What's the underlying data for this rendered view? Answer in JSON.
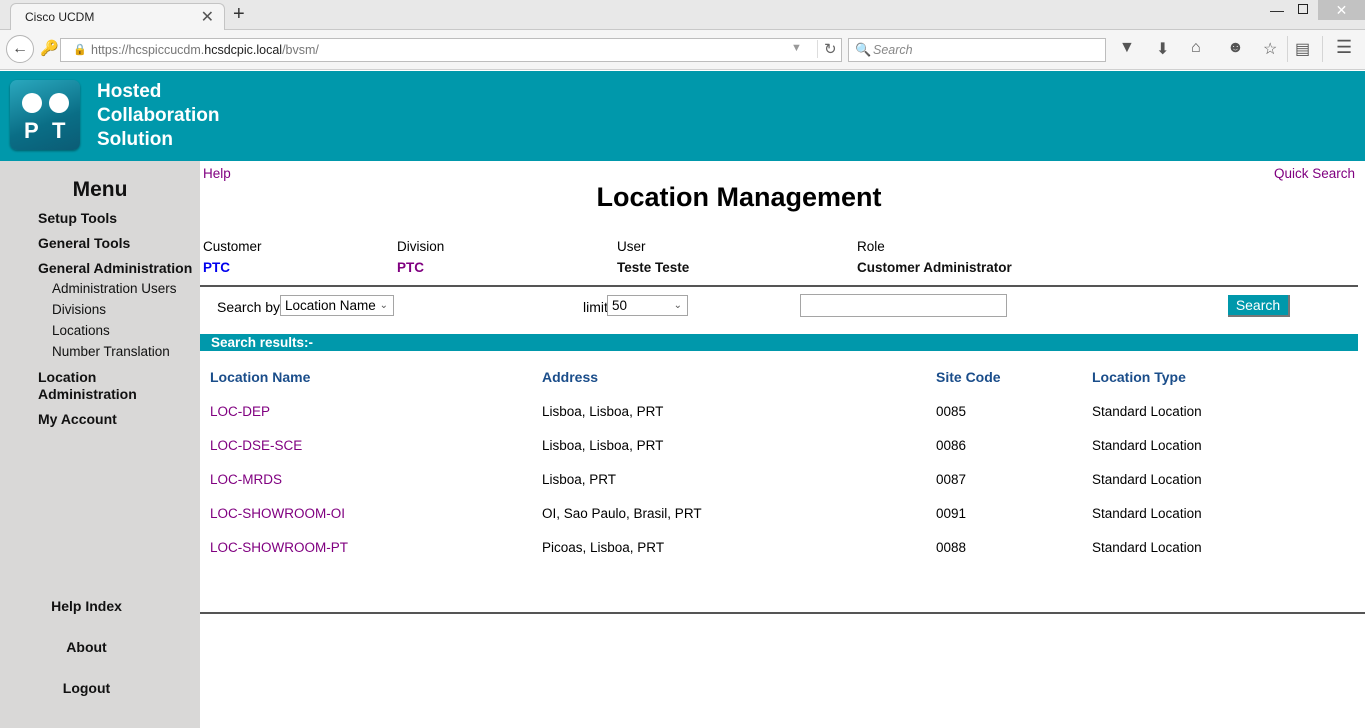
{
  "browser": {
    "tab_title": "Cisco UCDM",
    "tab_close": "✕",
    "new_tab": "+",
    "url_prefix": "https://hcspiccucdm.",
    "url_domain": "hcsdcpic.local",
    "url_path": "/bvsm/",
    "search_placeholder": "Search",
    "window_min": "—",
    "window_close": "✕"
  },
  "header": {
    "logo_letters": [
      "P",
      "T"
    ],
    "brand_lines": [
      "Hosted",
      "Collaboration",
      "Solution"
    ],
    "colors": {
      "teal": "#0098ab"
    }
  },
  "sidebar": {
    "title": "Menu",
    "items": [
      {
        "label": "Setup Tools"
      },
      {
        "label": "General Tools"
      },
      {
        "label": "General Administration",
        "children": [
          {
            "label": "Administration Users"
          },
          {
            "label": "Divisions"
          },
          {
            "label": "Locations"
          },
          {
            "label": "Number Translation"
          }
        ]
      },
      {
        "label": "Location Administration"
      },
      {
        "label": "My Account"
      }
    ],
    "footer": [
      {
        "label": "Help Index"
      },
      {
        "label": "About"
      },
      {
        "label": "Logout"
      }
    ]
  },
  "main": {
    "help_label": "Help",
    "quick_search_label": "Quick Search",
    "title": "Location Management",
    "info": {
      "customer_label": "Customer",
      "customer_value": "PTC",
      "division_label": "Division",
      "division_value": "PTC",
      "user_label": "User",
      "user_value": "Teste Teste",
      "role_label": "Role",
      "role_value": "Customer Administrator"
    },
    "search": {
      "search_by_label": "Search by",
      "search_by_selected": "Location Name",
      "limit_label": "limit",
      "limit_selected": "50",
      "query_value": "",
      "button_label": "Search"
    },
    "results_label": "Search results:-",
    "table": {
      "columns": [
        "Location Name",
        "Address",
        "Site Code",
        "Location Type"
      ],
      "rows": [
        {
          "name": "LOC-DEP",
          "address": "Lisboa, Lisboa, PRT",
          "site_code": "0085",
          "type": "Standard Location"
        },
        {
          "name": "LOC-DSE-SCE",
          "address": "Lisboa, Lisboa, PRT",
          "site_code": "0086",
          "type": "Standard Location"
        },
        {
          "name": "LOC-MRDS",
          "address": "Lisboa, PRT",
          "site_code": "0087",
          "type": "Standard Location"
        },
        {
          "name": "LOC-SHOWROOM-OI",
          "address": "OI, Sao Paulo, Brasil, PRT",
          "site_code": "0091",
          "type": "Standard Location"
        },
        {
          "name": "LOC-SHOWROOM-PT",
          "address": "Picoas, Lisboa, PRT",
          "site_code": "0088",
          "type": "Standard Location"
        }
      ]
    }
  }
}
